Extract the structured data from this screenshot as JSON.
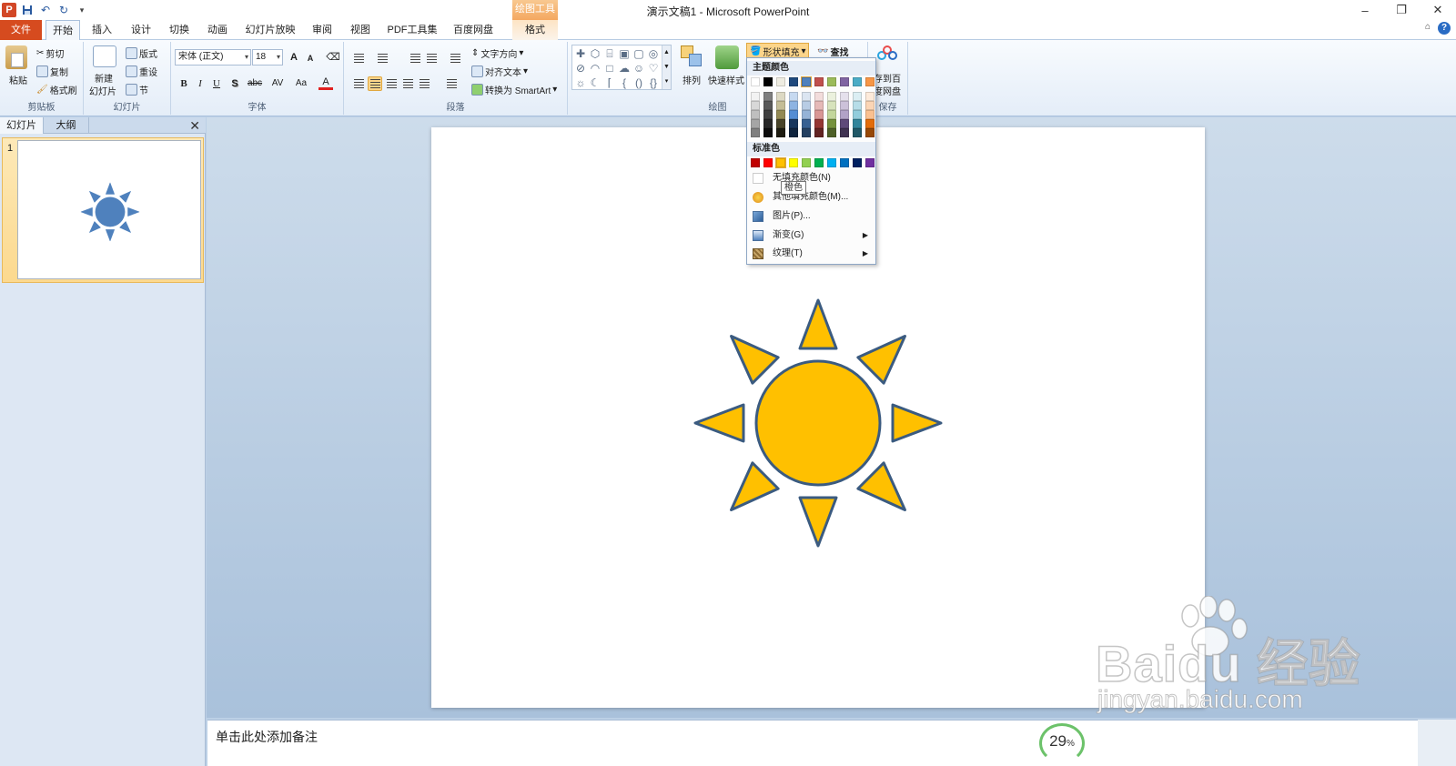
{
  "window": {
    "title": "演示文稿1 - Microsoft PowerPoint",
    "controls": {
      "minimize": "–",
      "restore": "❐",
      "close": "✕"
    }
  },
  "contextual_header": "绘图工具",
  "tabs": [
    {
      "label": "文件"
    },
    {
      "label": "开始"
    },
    {
      "label": "插入"
    },
    {
      "label": "设计"
    },
    {
      "label": "切换"
    },
    {
      "label": "动画"
    },
    {
      "label": "幻灯片放映"
    },
    {
      "label": "审阅"
    },
    {
      "label": "视图"
    },
    {
      "label": "PDF工具集"
    },
    {
      "label": "百度网盘"
    },
    {
      "label": "格式"
    }
  ],
  "ribbon": {
    "clipboard": {
      "paste": "粘贴",
      "cut": "剪切",
      "copy": "复制",
      "format_painter": "格式刷",
      "label": "剪贴板"
    },
    "slides": {
      "new_slide_1": "新建",
      "new_slide_2": "幻灯片",
      "layout": "版式",
      "reset": "重设",
      "section": "节",
      "label": "幻灯片"
    },
    "font": {
      "font_name": "宋体 (正文)",
      "font_size": "18",
      "label": "字体",
      "bold": "B",
      "italic": "I",
      "underline": "U",
      "shadow": "S",
      "strike": "abc",
      "spacing": "AV",
      "case": "Aa",
      "color": "A",
      "grow": "A",
      "shrink": "A"
    },
    "paragraph": {
      "text_direction": "文字方向",
      "align_text": "对齐文本",
      "smartart": "转换为 SmartArt",
      "label": "段落"
    },
    "drawing": {
      "arrange": "排列",
      "quick_styles": "快速样式",
      "shape_fill": "形状填充",
      "find": "查找",
      "label": "绘图"
    },
    "save": {
      "save_1": "存到百",
      "save_2": "度网盘",
      "label": "保存"
    }
  },
  "left_pane": {
    "tab_slides": "幻灯片",
    "tab_outline": "大纲",
    "close": "✕",
    "slide_number": "1"
  },
  "dropdown": {
    "theme_colors_label": "主题颜色",
    "standard_colors_label": "标准色",
    "theme_top_row": [
      "#ffffff",
      "#000000",
      "#eeece1",
      "#1f497d",
      "#4f81bd",
      "#c0504d",
      "#9bbb59",
      "#8064a2",
      "#4bacc6",
      "#f79646"
    ],
    "theme_columns": [
      [
        "#f2f2f2",
        "#d8d8d8",
        "#bfbfbf",
        "#a5a5a5",
        "#7f7f7f"
      ],
      [
        "#7f7f7f",
        "#595959",
        "#3f3f3f",
        "#262626",
        "#0c0c0c"
      ],
      [
        "#ddd9c3",
        "#c4bd97",
        "#938953",
        "#494429",
        "#1d1b10"
      ],
      [
        "#c6d9f0",
        "#8db3e2",
        "#548dd4",
        "#17365d",
        "#0f243e"
      ],
      [
        "#dbe5f1",
        "#b8cce4",
        "#95b3d7",
        "#366092",
        "#244061"
      ],
      [
        "#f2dcdb",
        "#e5b9b7",
        "#d99694",
        "#953734",
        "#632423"
      ],
      [
        "#ebf1dd",
        "#d7e3bc",
        "#c3d69b",
        "#76923c",
        "#4f6128"
      ],
      [
        "#e5e0ec",
        "#ccc1d9",
        "#b2a2c7",
        "#5f497a",
        "#3f3151"
      ],
      [
        "#dbeef3",
        "#b7dde8",
        "#92cddc",
        "#31859b",
        "#205867"
      ],
      [
        "#fdeada",
        "#fbd5b5",
        "#fac08f",
        "#e36c09",
        "#974806"
      ]
    ],
    "standard_colors": [
      "#c00000",
      "#ff0000",
      "#ffc000",
      "#ffff00",
      "#92d050",
      "#00b050",
      "#00b0f0",
      "#0070c0",
      "#002060",
      "#7030a0"
    ],
    "items": {
      "no_fill": "无填充颜色(N)",
      "more_colors": "其他填充颜色(M)...",
      "picture": "图片(P)...",
      "gradient": "渐变(G)",
      "texture": "纹理(T)"
    },
    "tooltip": "橙色"
  },
  "slide": {
    "sun_fill": "#ffc000",
    "sun_stroke": "#3b5b80",
    "thumb_fill": "#4f81bd"
  },
  "notes": {
    "placeholder": "单击此处添加备注"
  },
  "zoom_badge": {
    "value": "29",
    "unit": "%"
  },
  "watermark": {
    "brand": "Baidu 经验",
    "url": "jingyan.baidu.com"
  }
}
